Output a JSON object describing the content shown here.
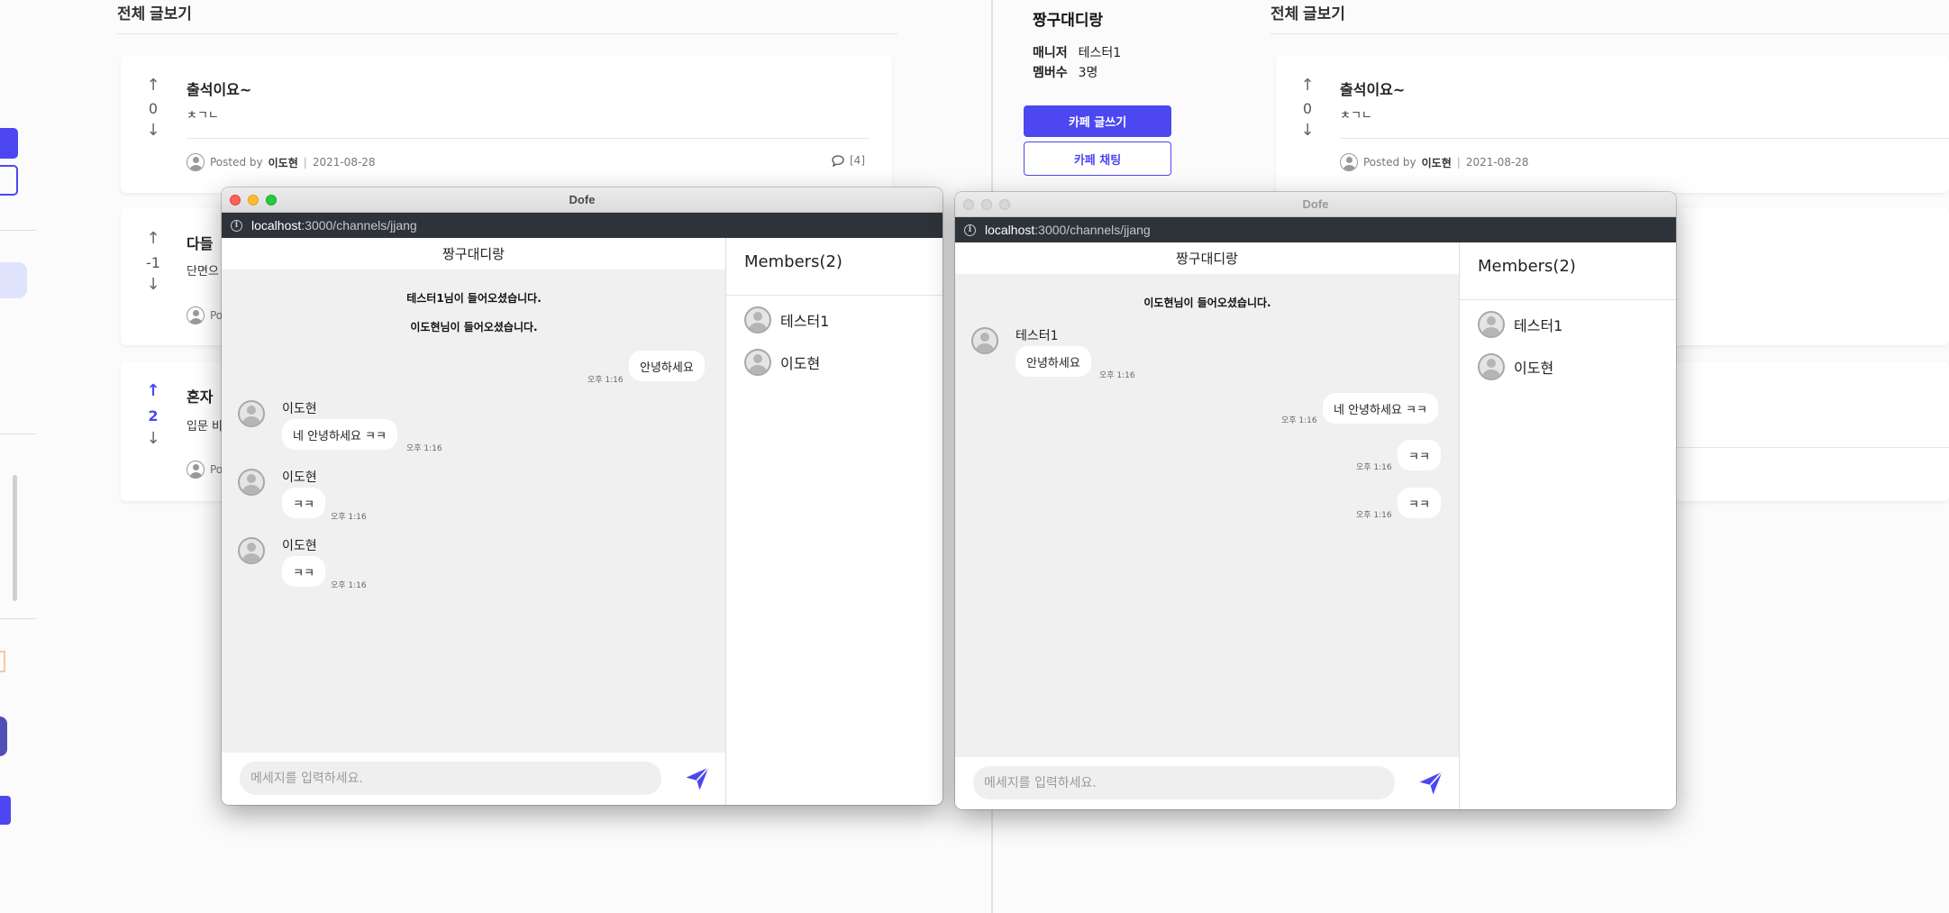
{
  "left_page": {
    "heading": "전체 글보기",
    "posts": [
      {
        "title": "출석이요~",
        "body": "ㅊㄱㄴ",
        "votes": "0",
        "posted_by": "Posted by",
        "author": "이도현",
        "date": "2021-08-28",
        "comments": "[4]"
      },
      {
        "title": "다들 ",
        "body": "단면으",
        "votes": "-1",
        "posted_by": "Po"
      },
      {
        "title": "혼자 ",
        "body": "입문 비",
        "votes": "2",
        "posted_by": "Po"
      }
    ]
  },
  "right_page": {
    "cafe_name": "짱구대디랑",
    "manager_label": "매니저",
    "manager_value": "테스터1",
    "members_label": "멤버수",
    "members_value": "3명",
    "write_button": "카페 글쓰기",
    "chat_button": "카페 채팅",
    "heading": "전체 글보기",
    "post": {
      "title": "출석이요~",
      "body": "ㅊㄱㄴ",
      "votes": "0",
      "posted_by": "Posted by",
      "author": "이도현",
      "date": "2021-08-28"
    }
  },
  "window1": {
    "title": "Dofe",
    "url_host": "localhost",
    "url_rest": ":3000/channels/jjang",
    "room_name": "짱구대디랑",
    "system_messages": [
      "테스터1님이 들어오셨습니다.",
      "이도현님이 들어오셨습니다."
    ],
    "mine": [
      {
        "text": "안녕하세요",
        "time": "오후 1:16"
      }
    ],
    "others": [
      {
        "sender": "이도현",
        "text": "네 안녕하세요 ㅋㅋ",
        "time": "오후 1:16"
      },
      {
        "sender": "이도현",
        "text": "ㅋㅋ",
        "time": "오후 1:16"
      },
      {
        "sender": "이도현",
        "text": "ㅋㅋ",
        "time": "오후 1:16"
      }
    ],
    "input_placeholder": "메세지를 입력하세요.",
    "members_title": "Members(2)",
    "members": [
      "테스터1",
      "이도현"
    ]
  },
  "window2": {
    "title": "Dofe",
    "url_host": "localhost",
    "url_rest": ":3000/channels/jjang",
    "room_name": "짱구대디랑",
    "system_messages": [
      "이도현님이 들어오셨습니다."
    ],
    "others": [
      {
        "sender": "테스터1",
        "text": "안녕하세요",
        "time": "오후 1:16"
      }
    ],
    "mine": [
      {
        "text": "네 안녕하세요 ㅋㅋ",
        "time": "오후 1:16"
      },
      {
        "text": "ㅋㅋ",
        "time": "오후 1:16"
      },
      {
        "text": "ㅋㅋ",
        "time": "오후 1:16"
      }
    ],
    "input_placeholder": "메세지를 입력하세요.",
    "members_title": "Members(2)",
    "members": [
      "테스터1",
      "이도현"
    ]
  },
  "icons": {
    "upvote": "arrow-up-icon",
    "downvote": "arrow-down-icon",
    "comment": "comment-icon",
    "send": "paper-plane-icon",
    "info": "info-icon",
    "avatar": "user-avatar-icon"
  },
  "colors": {
    "accent": "#4c47f0",
    "chat_bg": "#f0f0f0",
    "url_bar": "#2d3339"
  }
}
